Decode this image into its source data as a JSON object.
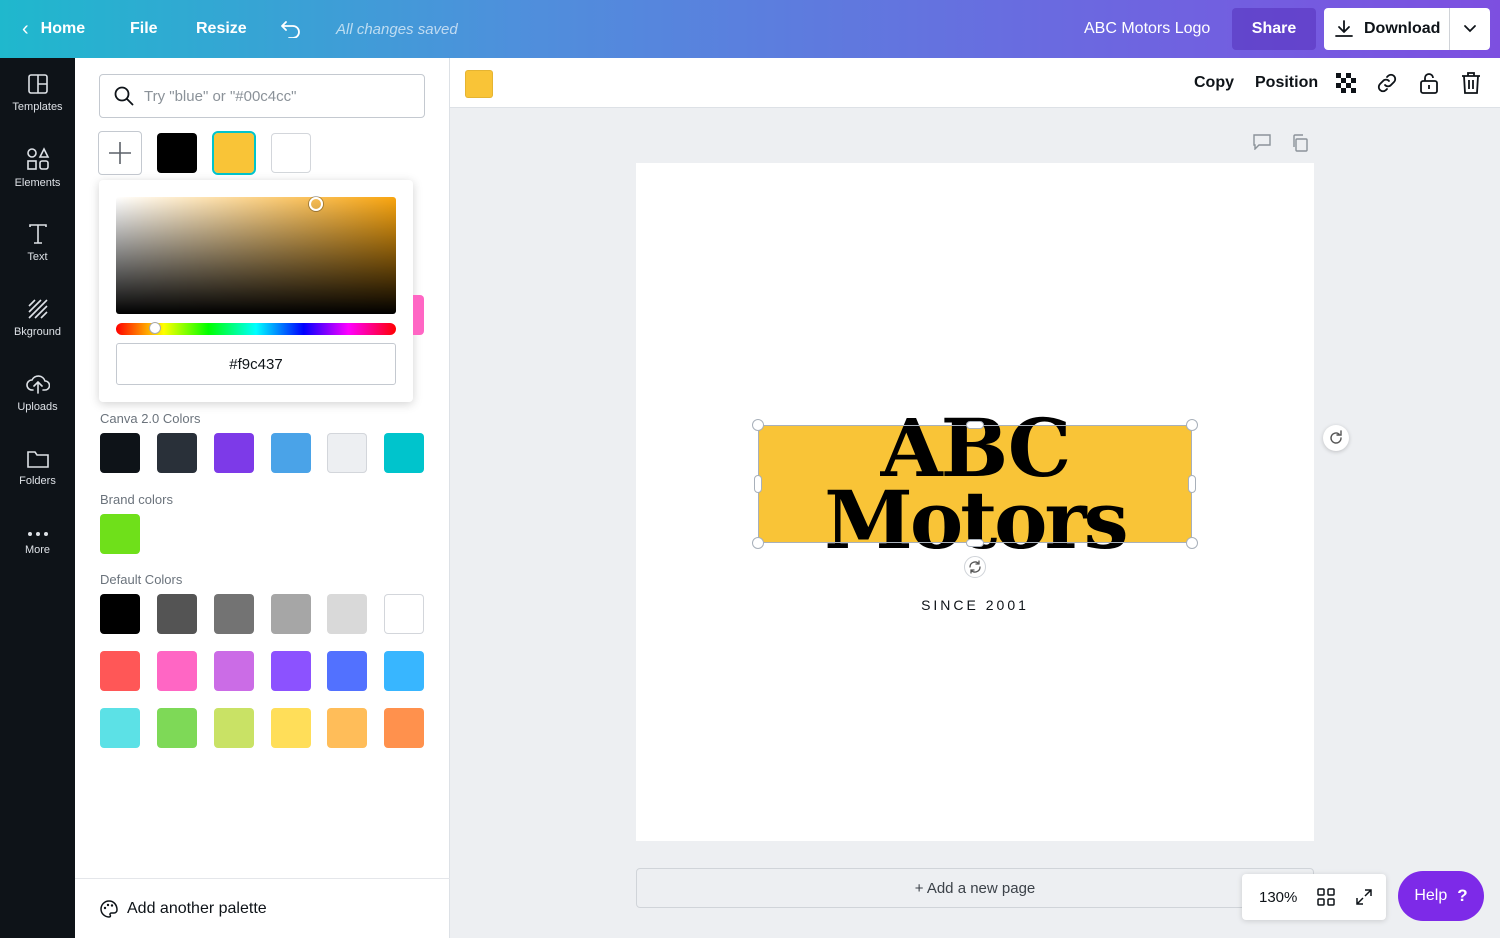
{
  "topbar": {
    "home": "Home",
    "file": "File",
    "resize": "Resize",
    "saved_status": "All changes saved",
    "design_title": "ABC Motors Logo",
    "share": "Share",
    "download": "Download"
  },
  "nav": [
    {
      "label": "Templates",
      "icon": "templates-icon"
    },
    {
      "label": "Elements",
      "icon": "elements-icon"
    },
    {
      "label": "Text",
      "icon": "text-icon"
    },
    {
      "label": "Bkground",
      "icon": "background-icon"
    },
    {
      "label": "Uploads",
      "icon": "uploads-icon"
    },
    {
      "label": "Folders",
      "icon": "folders-icon"
    },
    {
      "label": "More",
      "icon": "more-icon"
    }
  ],
  "panel": {
    "search_placeholder": "Try \"blue\" or \"#00c4cc\"",
    "document_colors": [
      "#000000",
      "#f9c437",
      "#ffffff"
    ],
    "selected_color": "#f9c437",
    "picker_hex": "#f9c437",
    "canva_label": "Canva 2.0 Colors",
    "canva_colors": [
      "#0e1318",
      "#293039",
      "#7d3ae8",
      "#4aa3e8",
      "#edeff2",
      "#00c4cc"
    ],
    "brand_label": "Brand colors",
    "brand_colors": [
      "#6fe01a"
    ],
    "default_label": "Default Colors",
    "default_colors": [
      "#000000",
      "#545454",
      "#737373",
      "#a6a6a6",
      "#d9d9d9",
      "#ffffff",
      "#ff5757",
      "#ff66c4",
      "#cb6ce6",
      "#8c52ff",
      "#5271ff",
      "#38b6ff",
      "#5ce1e6",
      "#7ed957",
      "#c9e265",
      "#ffde59",
      "#ffbd59",
      "#ff914d"
    ],
    "add_palette": "Add another palette"
  },
  "toolbar": {
    "copy": "Copy",
    "position": "Position"
  },
  "canvas": {
    "logo_line1": "ABC",
    "logo_line2": "Motors",
    "since": "SINCE 2001",
    "rect_color": "#f9c437",
    "add_page": "+ Add a new page"
  },
  "footer": {
    "zoom": "130%",
    "help": "Help",
    "help_q": "?"
  }
}
